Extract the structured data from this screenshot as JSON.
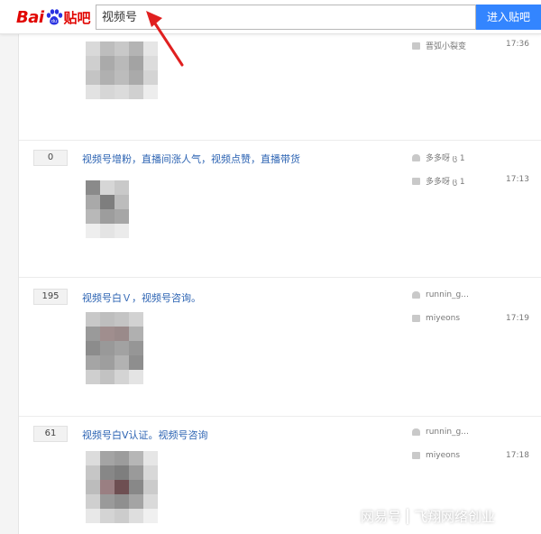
{
  "header": {
    "logo_text_bai": "Bai",
    "logo_text_tieba": "贴吧",
    "search_value": "视频号",
    "search_button_label": "进入贴吧"
  },
  "threads": [
    {
      "count": "",
      "title": "",
      "author": "",
      "last_reply": "晋弧小裂变",
      "time": "17:36"
    },
    {
      "count": "0",
      "title": "视频号增粉，直播间涨人气，视频点赞，直播带货",
      "author": "多多呀 ც 1",
      "last_reply": "多多呀 ც 1",
      "time": "17:13"
    },
    {
      "count": "195",
      "title": "视频号白Ｖ，视频号咨询。",
      "author": "runnin_g...",
      "last_reply": "miyeons",
      "time": "17:19"
    },
    {
      "count": "61",
      "title": "视频号白V认证。视频号咨询",
      "author": "runnin_g...",
      "last_reply": "miyeons",
      "time": "17:18"
    }
  ],
  "watermark": {
    "platform": "网易号",
    "account": "飞翔网络创业"
  },
  "colors": {
    "brand_red": "#e10602",
    "search_button": "#3385ff",
    "title_link": "#2d64b3",
    "annotation_arrow": "#e02020"
  }
}
